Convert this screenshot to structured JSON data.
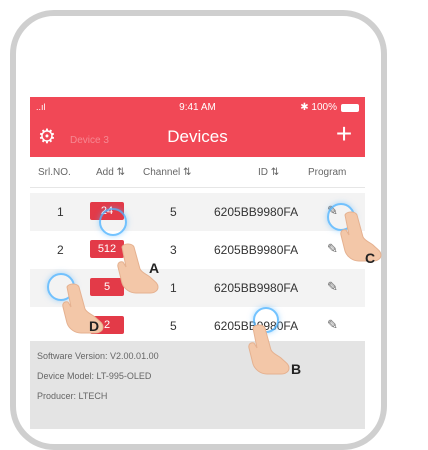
{
  "status": {
    "signal": "..ıl",
    "time": "9:41 AM",
    "battery": "✱ 100%"
  },
  "header": {
    "title": "Devices",
    "ghost": "Device 3",
    "settings_icon": "gear-icon",
    "add_icon": "plus-icon"
  },
  "columns": {
    "srl": "Srl.NO.",
    "add": "Add ⇅",
    "channel": "Channel ⇅",
    "id": "ID ⇅",
    "program": "Program"
  },
  "rows": [
    {
      "srl": "1",
      "add": "24",
      "channel": "5",
      "id": "6205BB9980FA"
    },
    {
      "srl": "2",
      "add": "512",
      "channel": "3",
      "id": "6205BB9980FA"
    },
    {
      "srl": "",
      "add": "5",
      "channel": "1",
      "id": "6205BB9980FA"
    },
    {
      "srl": "",
      "add": "2",
      "channel": "5",
      "id": "6205BB9980FA"
    }
  ],
  "info": {
    "software": "Software Version: V2.00.01.00",
    "model": "Device Model: LT-995-OLED",
    "producer": "Producer: LTECH"
  },
  "callouts": {
    "a": "A",
    "b": "B",
    "c": "C",
    "d": "D"
  }
}
